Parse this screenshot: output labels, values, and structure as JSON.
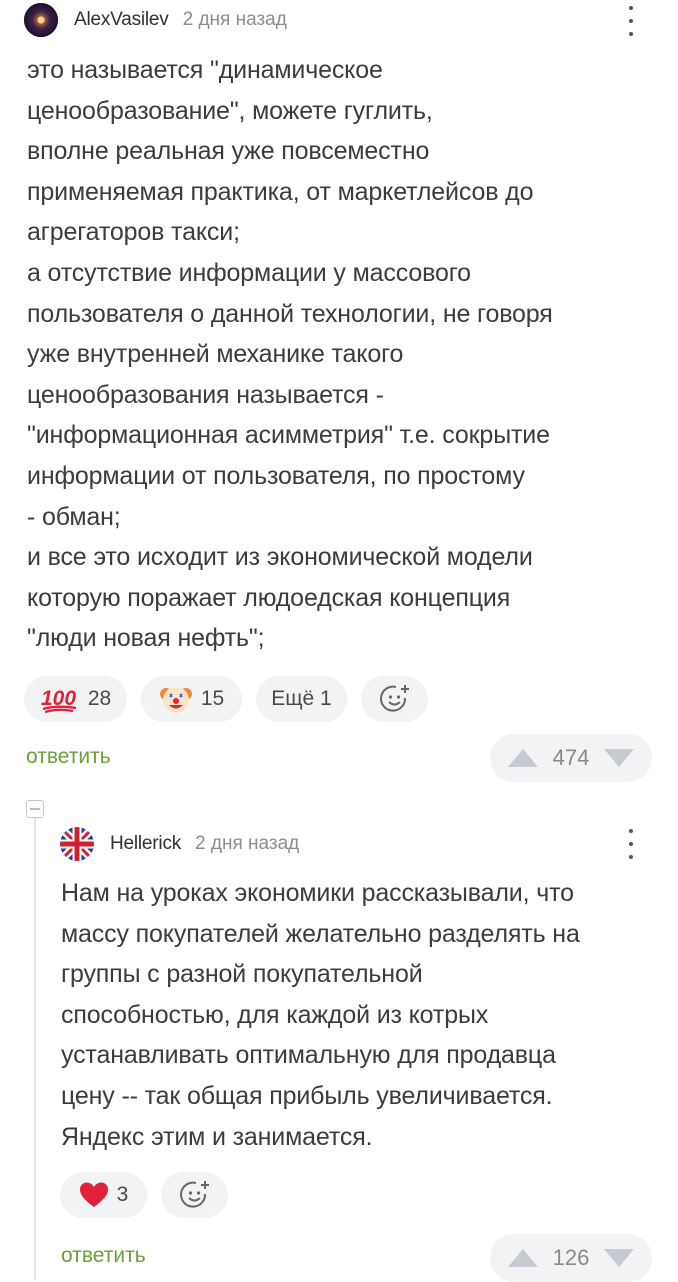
{
  "comments": [
    {
      "author": "AlexVasilev",
      "time": "2 дня назад",
      "text": "это называется \"динамическое\nценообразование\", можете гуглить,\nвполне реальная уже повсеместно\nприменяемая практика, от маркетлейсов до\nагрегаторов такси;\nа отсутствие информации у массового\nпользователя о данной технологии, не говоря\nуже внутренней механике такого\nценообразования называется -\n\"информационная асимметрия\" т.е. сокрытие\nинформации от пользователя, по простому\n- обман;\nи все это исходит из экономической модели\nкоторую поражает людоедская концепция\n\"люди новая нефть\";",
      "reactions": [
        {
          "icon": "hundred-points-icon",
          "glyph": "💯",
          "count": "28"
        },
        {
          "icon": "clown-face-icon",
          "glyph": "🤡",
          "count": "15"
        }
      ],
      "more_label": "Ещё 1",
      "reply_label": "ответить",
      "rating": "474"
    },
    {
      "author": "Hellerick",
      "time": "2 дня назад",
      "text": "Нам на уроках экономики рассказывали, что\nмассу покупателей желательно разделять на\nгруппы с разной покупательной\nспособностью, для каждой из котрых\nустанавливать оптимальную для продавца\nцену -- так общая прибыль увеличивается.\nЯндекс этим и занимается.",
      "reactions": [
        {
          "icon": "heart-icon",
          "glyph": "❤",
          "count": "3"
        }
      ],
      "reply_label": "ответить",
      "rating": "126"
    }
  ],
  "colors": {
    "reply_link": "#6b9e3c",
    "chip_bg": "#f2f3f5",
    "vote_arrow": "#c7cad0",
    "heart": "#e0213a"
  }
}
